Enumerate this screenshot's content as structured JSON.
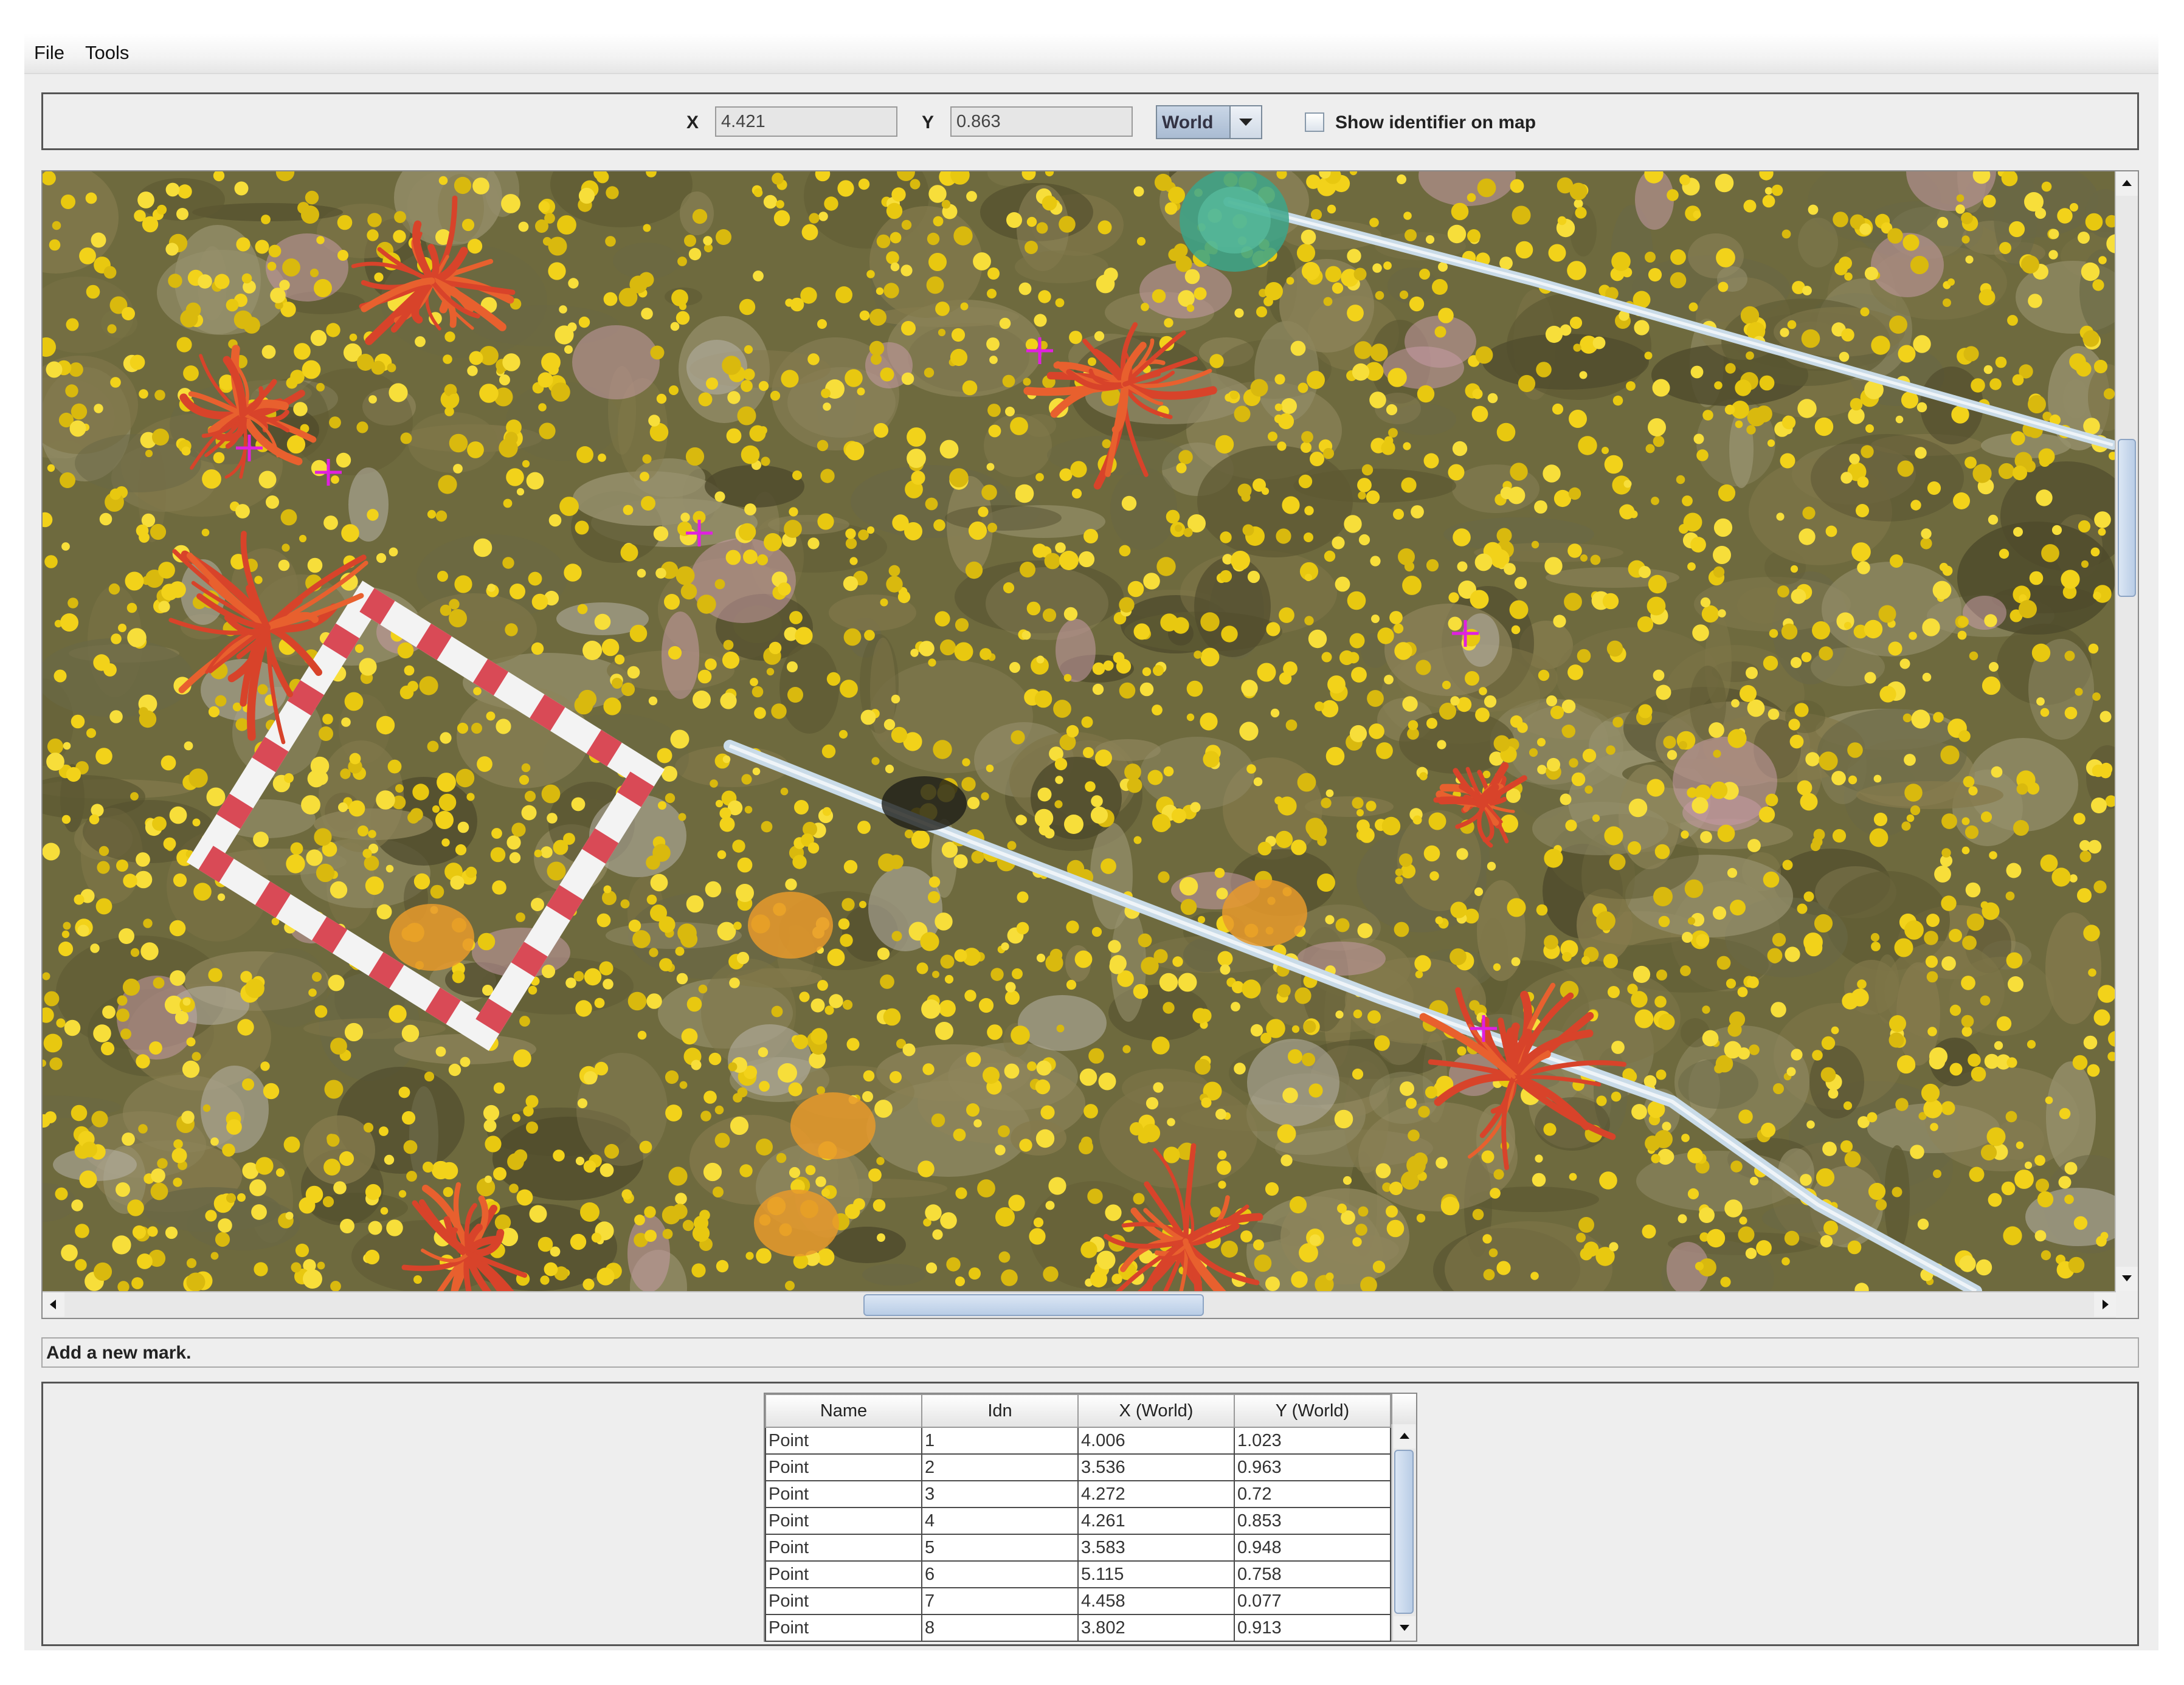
{
  "menu": {
    "items": [
      {
        "label": "File"
      },
      {
        "label": "Tools"
      }
    ]
  },
  "toolbar": {
    "x_label": "X",
    "x_value": "4.421",
    "y_label": "Y",
    "y_value": "0.863",
    "coord_system": "World",
    "show_identifier_label": "Show identifier on map",
    "show_identifier_checked": false
  },
  "map": {
    "marker_color": "#e020e0"
  },
  "status": {
    "text": "Add a new mark."
  },
  "table": {
    "columns": [
      "Name",
      "Idn",
      "X (World)",
      "Y (World)"
    ],
    "rows": [
      [
        "Point",
        "1",
        "4.006",
        "1.023"
      ],
      [
        "Point",
        "2",
        "3.536",
        "0.963"
      ],
      [
        "Point",
        "3",
        "4.272",
        "0.72"
      ],
      [
        "Point",
        "4",
        "4.261",
        "0.853"
      ],
      [
        "Point",
        "5",
        "3.583",
        "0.948"
      ],
      [
        "Point",
        "6",
        "5.115",
        "0.758"
      ],
      [
        "Point",
        "7",
        "4.458",
        "0.077"
      ],
      [
        "Point",
        "8",
        "3.802",
        "0.913"
      ]
    ]
  }
}
